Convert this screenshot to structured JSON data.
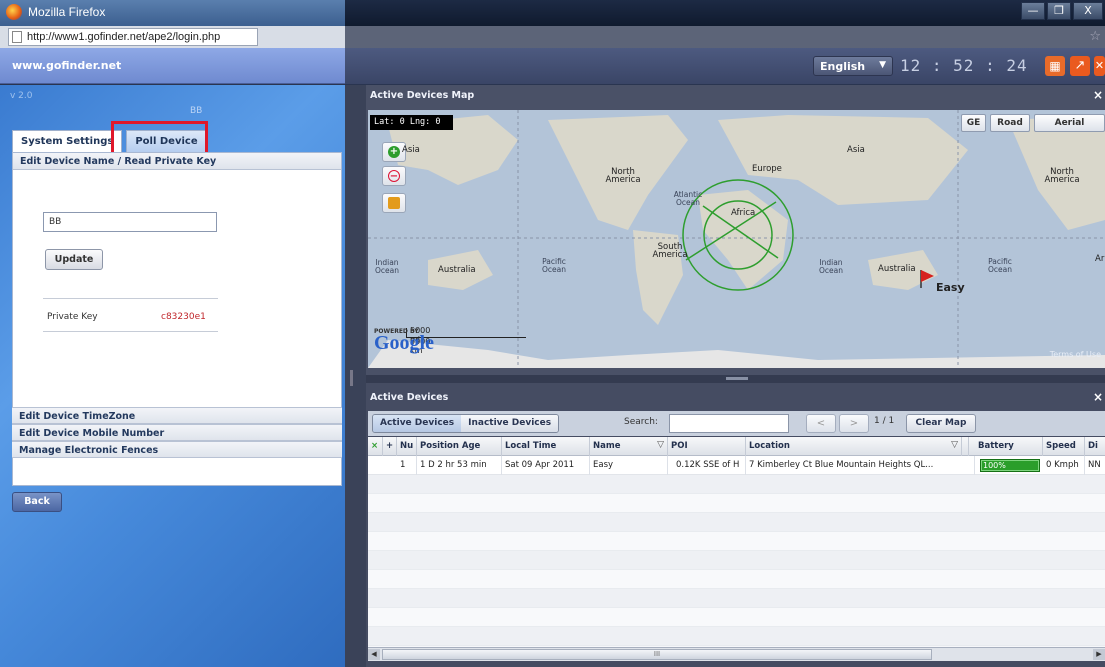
{
  "window": {
    "title": "Mozilla Firefox",
    "buttons": {
      "minimize": "—",
      "maximize": "❐",
      "close": "X"
    }
  },
  "browser": {
    "url": "http://www1.gofinder.net/ape2/login.php"
  },
  "header": {
    "site": "www.gofinder.net",
    "language": "English",
    "clock": "12 : 52 : 24"
  },
  "left_panel": {
    "version": "v 2.0",
    "device": "BB",
    "tabs": [
      "System Settings",
      "Poll Device"
    ],
    "sections": {
      "edit_name": "Edit Device Name / Read Private Key",
      "timezone": "Edit Device TimeZone",
      "mobile": "Edit Device Mobile Number",
      "fences": "Manage Electronic Fences"
    },
    "name_value": "BB",
    "update_label": "Update",
    "private_key_label": "Private Key",
    "private_key_value": "c83230e1",
    "back_label": "Back"
  },
  "map_panel": {
    "title": "Active Devices Map",
    "coords": "Lat: 0   Lng: 0",
    "types": [
      "GE",
      "Road",
      "Aerial"
    ],
    "labels": {
      "asia_left": "Asia",
      "asia": "Asia",
      "north_america": "North America",
      "north_america_right": "North America",
      "europe": "Europe",
      "atlantic": "Atlantic Ocean",
      "africa": "Africa",
      "south_america": "South America",
      "indian_left": "Indian Ocean",
      "australia_left": "Australia",
      "pacific_left": "Pacific Ocean",
      "indian": "Indian Ocean",
      "australia": "Australia",
      "pacific": "Pacific Ocean",
      "far_right": "Ar"
    },
    "marker": "Easy",
    "scale": [
      "5000 mi",
      "5000 km"
    ],
    "powered_by": "POWERED BY",
    "google": "Google",
    "terms": "Terms of Use"
  },
  "devices_panel": {
    "title": "Active Devices",
    "toggle": [
      "Active Devices",
      "Inactive Devices"
    ],
    "search_label": "Search:",
    "page_info": "1 / 1",
    "clear_map": "Clear Map",
    "prev": "<",
    "next": ">",
    "columns": [
      "×",
      "+",
      "Nu",
      "Position Age",
      "Local Time",
      "Name",
      "POI",
      "Location",
      "Battery",
      "Speed",
      "Di"
    ],
    "row": {
      "num": "1",
      "age": "1 D 2 hr 53 min",
      "time": "Sat 09 Apr 2011",
      "name": "Easy",
      "poi": "0.12K SSE of H",
      "location": "7 Kimberley Ct Blue Mountain Heights QL...",
      "battery": "100%",
      "speed": "0 Kmph",
      "dir": "NN"
    },
    "scroll_grip": "III"
  },
  "colors": {
    "accent": "#3f7bd0",
    "highlight": "#e0182a",
    "battery": "#2a9e2a"
  }
}
